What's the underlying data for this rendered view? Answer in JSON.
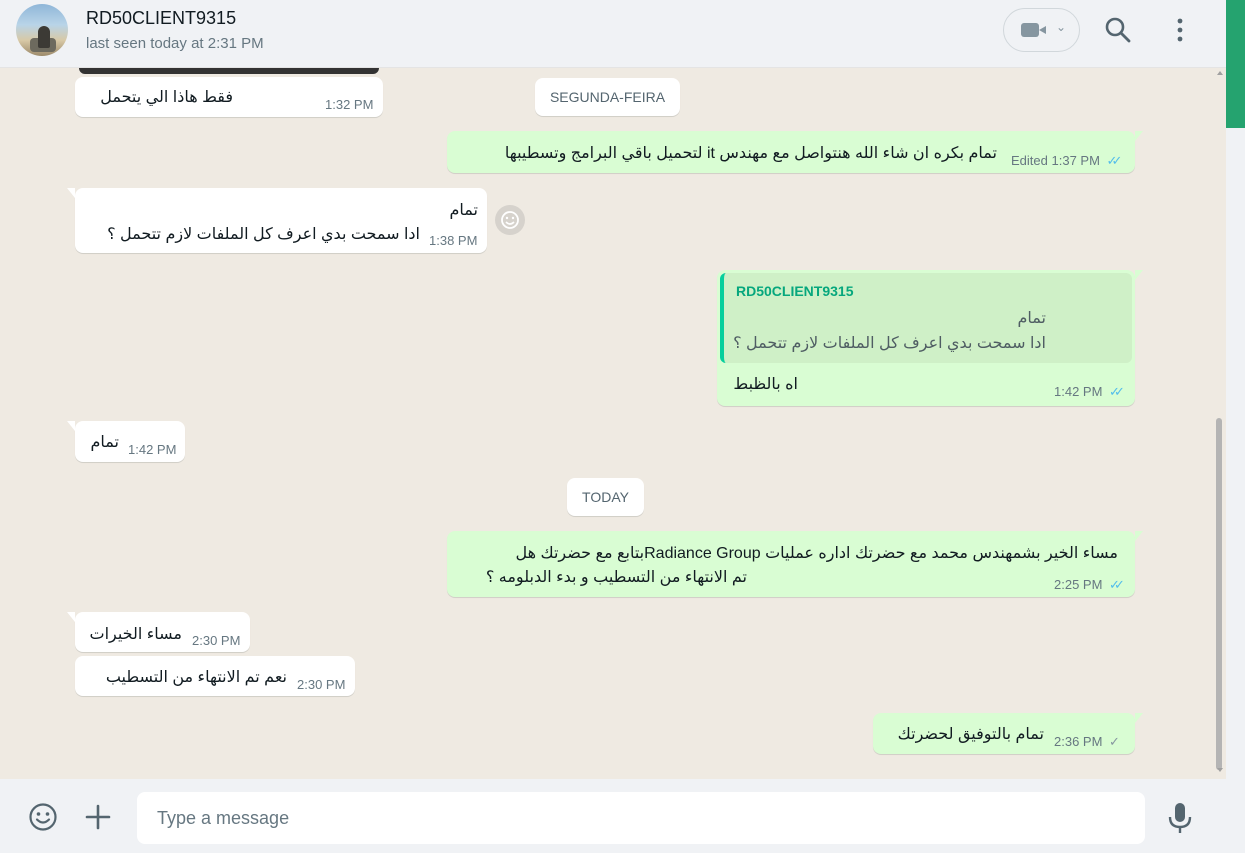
{
  "header": {
    "contact_name": "RD50CLIENT9315",
    "status": "last seen today at 2:31 PM",
    "icons": [
      "video-call-icon",
      "search-icon",
      "menu-icon"
    ]
  },
  "date_chips": {
    "monday": "SEGUNDA-FEIRA",
    "today": "TODAY"
  },
  "messages": [
    {
      "dir": "in",
      "text": "فقط هاذا الي يتحمل",
      "time": "1:32 PM"
    },
    {
      "dir": "out",
      "text": "تمام بكره ان شاء الله هنتواصل مع مهندس it لتحميل باقي البرامج وتسطيبها",
      "edited": "Edited",
      "time": "1:37 PM",
      "status": "read"
    },
    {
      "dir": "in",
      "line1": "تمام",
      "line2": "ادا سمحت بدي اعرف كل الملفات لازم تتحمل ؟",
      "time": "1:38 PM"
    },
    {
      "dir": "out",
      "quote_name": "RD50CLIENT9315",
      "quote_line1": "تمام",
      "quote_line2": "ادا سمحت بدي اعرف كل الملفات لازم تتحمل ؟",
      "text": "اه بالظبط",
      "time": "1:42 PM",
      "status": "read"
    },
    {
      "dir": "in",
      "text": "تمام",
      "time": "1:42 PM"
    },
    {
      "dir": "out",
      "line1": "مساء الخير بشمهندس محمد مع  حضرتك اداره عمليات Radiance Groupبتابع مع حضرتك هل",
      "line2": "تم الانتهاء من التسطيب و بدء الدبلومه ؟",
      "time": "2:25 PM",
      "status": "read"
    },
    {
      "dir": "in",
      "text": "مساء الخيرات",
      "time": "2:30 PM"
    },
    {
      "dir": "in",
      "text": "نعم تم الانتهاء من التسطيب",
      "time": "2:30 PM"
    },
    {
      "dir": "out",
      "text": "تمام بالتوفيق لحضرتك",
      "time": "2:36 PM",
      "status": "sent"
    }
  ],
  "ticks": {
    "read": "✓✓",
    "sent": "✓"
  },
  "composer": {
    "placeholder": "Type a message"
  },
  "colors": {
    "outgoing_bubble": "#d9fdd3",
    "incoming_bubble": "#ffffff",
    "accent": "#25a36f",
    "read_tick": "#53bdeb"
  }
}
